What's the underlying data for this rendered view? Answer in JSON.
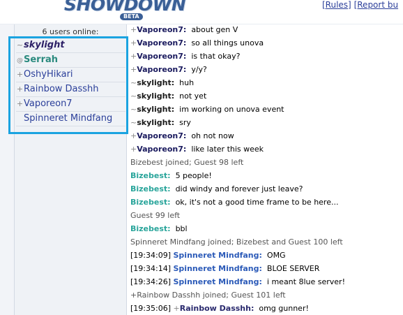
{
  "header": {
    "logo_text": "SHOWDOWN",
    "logo_badge": "BETA",
    "links": [
      "[Rules]",
      "[Report bu"
    ],
    "link_sep": " "
  },
  "sidebar": {
    "users_online": "6 users online:",
    "users": [
      {
        "group": "~",
        "name": "skylight",
        "role": "admin"
      },
      {
        "group": "@",
        "name": "Serrah",
        "role": "mod"
      },
      {
        "group": "+",
        "name": "OshyHikari",
        "role": "voice"
      },
      {
        "group": "+",
        "name": "Rainbow Dasshh",
        "role": "voice"
      },
      {
        "group": "+",
        "name": "Vaporeon7",
        "role": "voice"
      },
      {
        "group": " ",
        "name": "Spinneret Mindfang",
        "role": "plain"
      }
    ]
  },
  "chat": {
    "lines": [
      {
        "ts": "",
        "grp": "+",
        "who": "Vaporeon7:",
        "msg": "about gen V",
        "c": ""
      },
      {
        "ts": "",
        "grp": "+",
        "who": "Vaporeon7:",
        "msg": "so all things unova",
        "c": ""
      },
      {
        "ts": "",
        "grp": "+",
        "who": "Vaporeon7:",
        "msg": "is that okay?",
        "c": ""
      },
      {
        "ts": "",
        "grp": "+",
        "who": "Vaporeon7:",
        "msg": "y/y?",
        "c": ""
      },
      {
        "ts": "",
        "grp": "~",
        "who": "skylight:",
        "msg": "huh",
        "c": "c-skylight"
      },
      {
        "ts": "",
        "grp": "~",
        "who": "skylight:",
        "msg": "not yet",
        "c": "c-skylight"
      },
      {
        "ts": "",
        "grp": "~",
        "who": "skylight:",
        "msg": "im working on unova event",
        "c": "c-skylight"
      },
      {
        "ts": "",
        "grp": "~",
        "who": "skylight:",
        "msg": "sry",
        "c": "c-skylight"
      },
      {
        "ts": "",
        "grp": "+",
        "who": "Vaporeon7:",
        "msg": "oh not now",
        "c": ""
      },
      {
        "ts": "",
        "grp": "+",
        "who": "Vaporeon7:",
        "msg": "like later this week",
        "c": ""
      },
      {
        "notice": "Bizebest joined; Guest 98 left"
      },
      {
        "ts": "",
        "grp": "",
        "who": "Bizebest:",
        "msg": "5 people!",
        "c": "c-bize"
      },
      {
        "ts": "",
        "grp": "",
        "who": "Bizebest:",
        "msg": "did windy and forever just leave?",
        "c": "c-bize"
      },
      {
        "ts": "",
        "grp": "",
        "who": "Bizebest:",
        "msg": "ok, it's not a good time frame to be here...",
        "c": "c-bize"
      },
      {
        "notice": "Guest 99 left"
      },
      {
        "ts": "",
        "grp": "",
        "who": "Bizebest:",
        "msg": "bbl",
        "c": "c-bize"
      },
      {
        "notice": "Spinneret Mindfang joined; Bizebest and Guest 100 left"
      },
      {
        "ts": "[19:34:09]",
        "grp": "",
        "who": "Spinneret Mindfang:",
        "msg": "OMG",
        "c": "c-spin"
      },
      {
        "ts": "[19:34:14]",
        "grp": "",
        "who": "Spinneret Mindfang:",
        "msg": "BLOE SERVER",
        "c": "c-spin"
      },
      {
        "ts": "[19:34:26]",
        "grp": "",
        "who": "Spinneret Mindfang:",
        "msg": "i meant 8lue server!",
        "c": "c-spin"
      },
      {
        "notice": "+Rainbow Dasshh joined; Guest 101 left"
      },
      {
        "ts": "[19:35:06]",
        "grp": "+",
        "who": "Rainbow Dasshh:",
        "msg": "omg gunner!",
        "c": "c-rain"
      }
    ]
  }
}
